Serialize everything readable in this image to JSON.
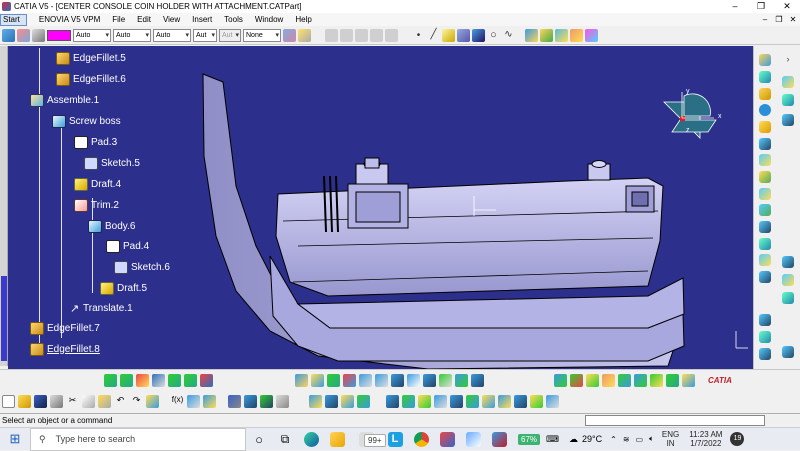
{
  "window": {
    "title": "CATIA V5 - [CENTER CONSOLE COIN HOLDER WITH ATTACHMENT.CATPart]",
    "controls": [
      "–",
      "❐",
      "✕"
    ]
  },
  "menu": {
    "start": "Start",
    "items": [
      "ENOVIA V5 VPM",
      "File",
      "Edit",
      "View",
      "Insert",
      "Tools",
      "Window",
      "Help"
    ],
    "doc_controls": [
      "–",
      "❐",
      "✕"
    ]
  },
  "toolbar": {
    "color_swatch": "#ff00ff",
    "dropdowns": [
      {
        "name": "transparency-select",
        "value": "Auto",
        "width": 38
      },
      {
        "name": "line-thickness-select",
        "value": "Auto",
        "width": 38
      },
      {
        "name": "linetype-select",
        "value": "Auto",
        "width": 38
      },
      {
        "name": "point-symbol-select",
        "value": "Aut",
        "width": 24
      },
      {
        "name": "rendering-style-select",
        "value": "Aut",
        "width": 22
      },
      {
        "name": "layer-select",
        "value": "None",
        "width": 38
      }
    ]
  },
  "tree": {
    "nodes": [
      {
        "label": "EdgeFillet.5",
        "icon": "edge-fillet-icon",
        "underline": false
      },
      {
        "label": "EdgeFillet.6",
        "icon": "edge-fillet-icon",
        "underline": false
      },
      {
        "label": "Assemble.1",
        "icon": "assemble-icon",
        "underline": false
      },
      {
        "label": "Screw boss",
        "icon": "body-icon",
        "underline": false
      },
      {
        "label": "Pad.3",
        "icon": "pad-icon",
        "underline": false
      },
      {
        "label": "Sketch.5",
        "icon": "sketch-icon",
        "underline": false
      },
      {
        "label": "Draft.4",
        "icon": "draft-icon",
        "underline": false
      },
      {
        "label": "Trim.2",
        "icon": "trim-icon",
        "underline": false
      },
      {
        "label": "Body.6",
        "icon": "body-icon",
        "underline": false
      },
      {
        "label": "Pad.4",
        "icon": "pad-icon",
        "underline": false
      },
      {
        "label": "Sketch.6",
        "icon": "sketch-icon",
        "underline": false
      },
      {
        "label": "Draft.5",
        "icon": "draft-icon",
        "underline": false
      },
      {
        "label": "Translate.1",
        "icon": "translate-icon",
        "underline": false
      },
      {
        "label": "EdgeFillet.7",
        "icon": "edge-fillet-icon",
        "underline": false
      },
      {
        "label": "EdgeFillet.8",
        "icon": "edge-fillet-icon",
        "underline": true
      }
    ]
  },
  "compass": {
    "x_label": "x",
    "y_label": "y",
    "z_label": "z"
  },
  "status": {
    "message": "Select an object or a command"
  },
  "taskbar": {
    "search_placeholder": "Type here to search",
    "badge_count": "99+",
    "battery": "67%",
    "temperature": "29°C",
    "language": "ENG",
    "region": "IN",
    "time": "11:23 AM",
    "date": "1/7/2022",
    "notif_count": "19"
  },
  "brand": {
    "name": "CATIA"
  },
  "colors": {
    "viewport_bg": "#2d2f8c",
    "part": "#b9b8e8",
    "accent": "#3a3ad0"
  }
}
